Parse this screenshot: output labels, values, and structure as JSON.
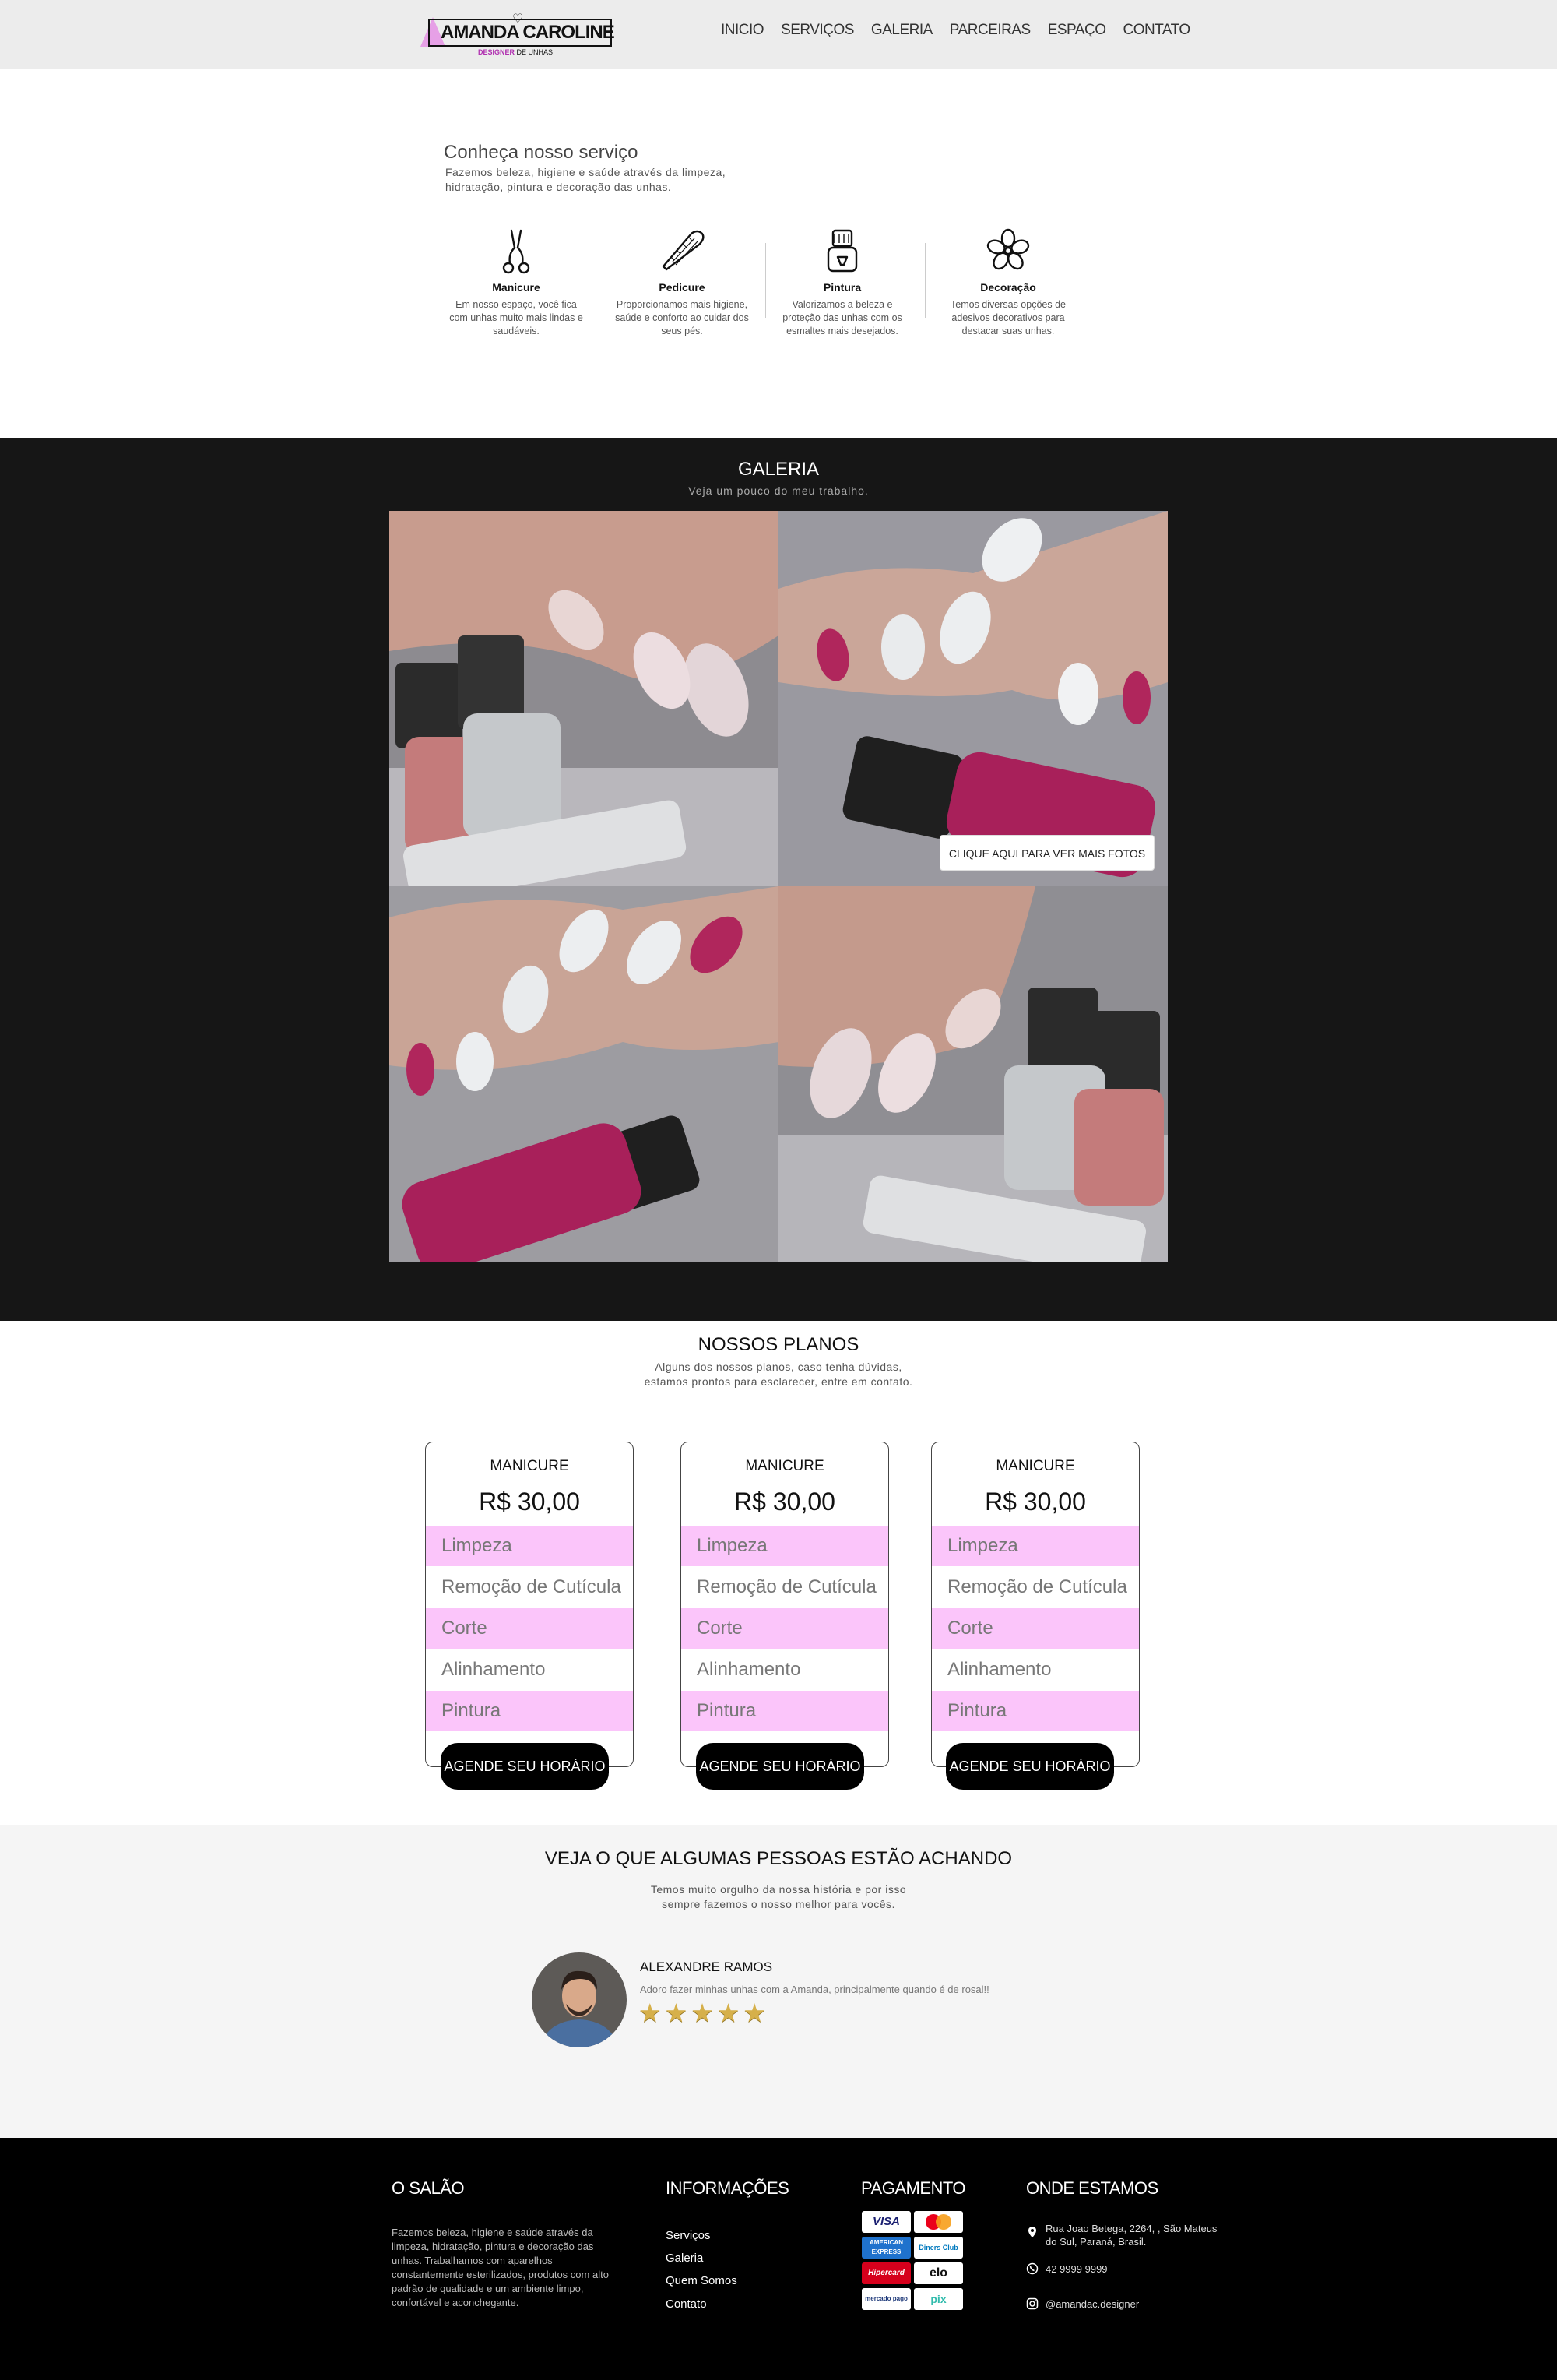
{
  "brand": {
    "logo_text": "AMANDA CAROLINE",
    "logo_sub_a": "DESIGNER",
    "logo_sub_b": " DE UNHAS"
  },
  "nav": [
    "INICIO",
    "SERVIÇOS",
    "GALERIA",
    "PARCEIRAS",
    "ESPAÇO",
    "CONTATO"
  ],
  "services": {
    "title": "Conheça nosso serviço",
    "description": "Fazemos beleza, higiene e saúde através da limpeza, hidratação, pintura e decoração das unhas.",
    "items": [
      {
        "name": "Manicure",
        "text": "Em nosso espaço, você fica com unhas muito mais lindas e saudáveis.",
        "icon": "nail-clipper-icon"
      },
      {
        "name": "Pedicure",
        "text": "Proporcionamos mais higiene, saúde e conforto ao cuidar dos seus pés.",
        "icon": "nail-file-icon"
      },
      {
        "name": "Pintura",
        "text": "Valorizamos a beleza e proteção das unhas com os esmaltes mais desejados.",
        "icon": "nail-polish-icon"
      },
      {
        "name": "Decoração",
        "text": "Temos diversas opções de adesivos decorativos para destacar suas unhas.",
        "icon": "flower-icon"
      }
    ]
  },
  "gallery": {
    "title": "GALERIA",
    "subtitle": "Veja um pouco do meu trabalho.",
    "more_button": "CLIQUE AQUI PARA VER MAIS FOTOS"
  },
  "plans": {
    "title": "NOSSOS PLANOS",
    "subtitle_line1": "Alguns dos nossos planos, caso tenha dúvidas,",
    "subtitle_line2": "estamos prontos para esclarecer, entre em contato.",
    "cards": [
      {
        "name": "MANICURE",
        "price": "R$  30,00",
        "items": [
          "Limpeza",
          "Remoção de Cutícula",
          "Corte",
          "Alinhamento",
          "Pintura"
        ],
        "button": "AGENDE SEU HORÁRIO"
      },
      {
        "name": "MANICURE",
        "price": "R$  30,00",
        "items": [
          "Limpeza",
          "Remoção de Cutícula",
          "Corte",
          "Alinhamento",
          "Pintura"
        ],
        "button": "AGENDE SEU HORÁRIO"
      },
      {
        "name": "MANICURE",
        "price": "R$  30,00",
        "items": [
          "Limpeza",
          "Remoção de Cutícula",
          "Corte",
          "Alinhamento",
          "Pintura"
        ],
        "button": "AGENDE SEU HORÁRIO"
      }
    ],
    "highlight_color": "#fbc5fa"
  },
  "testimonials": {
    "title": "VEJA O QUE ALGUMAS PESSOAS ESTÃO ACHANDO",
    "subtitle_line1": "Temos muito orgulho da nossa história e por isso",
    "subtitle_line2": "sempre fazemos o nosso melhor para vocês.",
    "items": [
      {
        "name": "ALEXANDRE RAMOS",
        "quote": "Adoro fazer minhas unhas com a Amanda, principalmente quando é de rosal!!",
        "rating": 5
      }
    ]
  },
  "footer": {
    "salon_title": "O SALÃO",
    "salon_text": "Fazemos beleza, higiene e saúde através da limpeza, hidratação, pintura e decoração das unhas. Trabalhamos com aparelhos constantemente esterilizados, produtos com alto padrão de qualidade e um ambiente limpo, confortável e aconchegante.",
    "info_title": "INFORMAÇÕES",
    "links": [
      "Serviços",
      "Galeria",
      "Quem Somos",
      "Contato"
    ],
    "payment_title": "PAGAMENTO",
    "payments": [
      "VISA",
      "mastercard",
      "AMERICAN EXPRESS",
      "Diners Club",
      "Hipercard",
      "elo",
      "mercado pago",
      "pix"
    ],
    "location_title": "ONDE ESTAMOS",
    "address_line1": "Rua Joao Betega, 2264, , São Mateus",
    "address_line2": "do Sul, Paraná, Brasil.",
    "phone": "42 9999 9999",
    "instagram": "@amandac.designer"
  }
}
